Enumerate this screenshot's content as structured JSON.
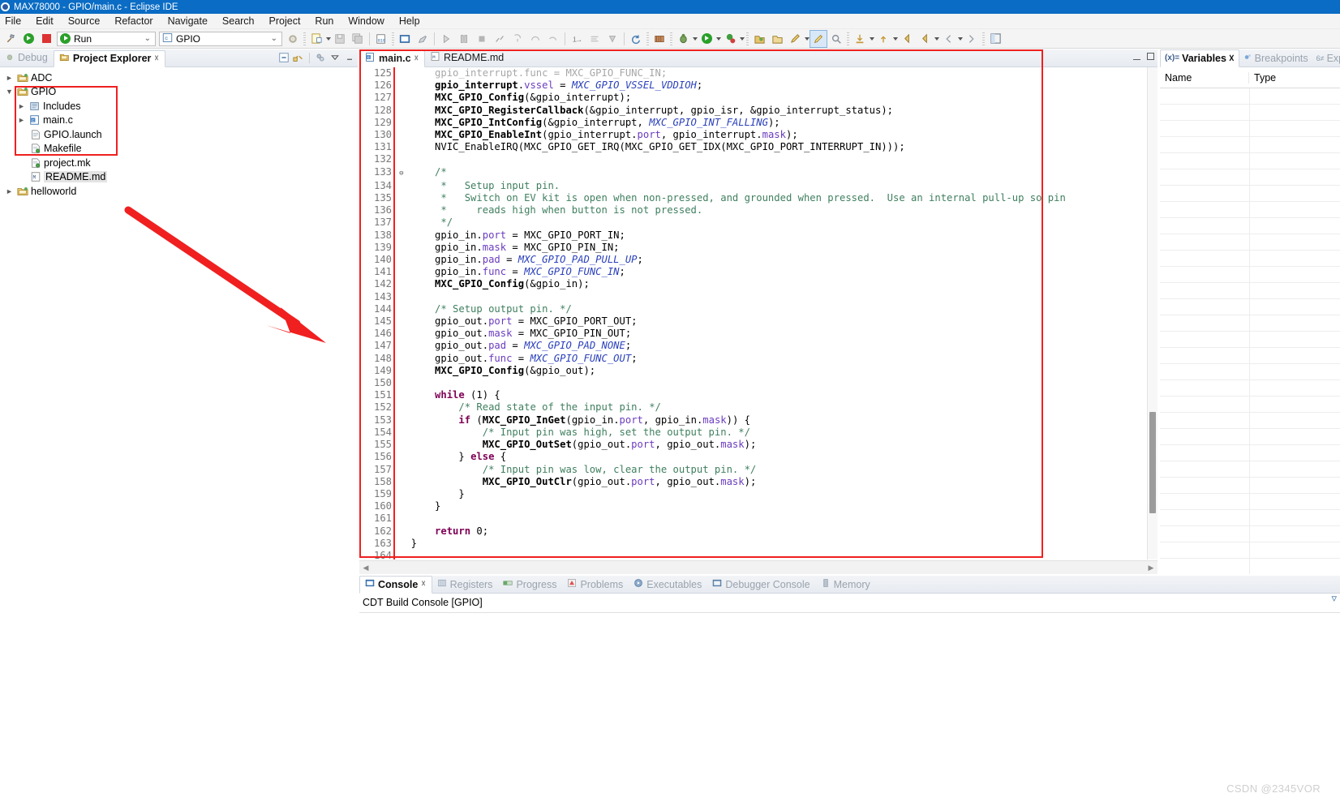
{
  "window": {
    "title": "MAX78000 - GPIO/main.c - Eclipse IDE",
    "app_icon": "eclipse-icon"
  },
  "menubar": {
    "items": [
      "File",
      "Edit",
      "Source",
      "Refactor",
      "Navigate",
      "Search",
      "Project",
      "Run",
      "Window",
      "Help"
    ]
  },
  "toolbar": {
    "run_config_label": "Run",
    "project_label": "GPIO",
    "icons": [
      "build-hammer-icon",
      "run-icon",
      "stop-icon",
      "new-file-icon",
      "save-icon",
      "save-all-icon",
      "binary-icon",
      "console-icon",
      "marker-icon",
      "resume-icon",
      "suspend-icon",
      "terminate-icon",
      "disconnect-icon",
      "step-into-icon",
      "step-over-icon",
      "step-return-icon",
      "instruction-step-icon",
      "skip-breakpoints-icon",
      "drop-to-frame-icon",
      "refresh-icon",
      "bug-icon",
      "external-tools-icon",
      "run-dropdown-icon",
      "debug-dropdown-icon",
      "open-type-icon",
      "open-resource-icon",
      "pencil-icon",
      "highlight-icon",
      "search-icon",
      "download-icon",
      "upload-icon",
      "back-icon",
      "forward-icon",
      "perspective-icon"
    ]
  },
  "left_panel": {
    "tabs": [
      {
        "label": "Debug",
        "icon": "debug-icon",
        "active": false,
        "closeable": false
      },
      {
        "label": "Project Explorer",
        "icon": "project-explorer-icon",
        "active": true,
        "closeable": true
      }
    ],
    "view_tools": [
      "collapse-all-icon",
      "link-editor-icon",
      "filter-icon",
      "view-menu-icon",
      "minimize-icon"
    ],
    "tree": [
      {
        "label": "ADC",
        "icon": "c-project-icon",
        "indent": 1,
        "arrow": "collapsed",
        "selected": false
      },
      {
        "label": "GPIO",
        "icon": "c-project-icon",
        "indent": 1,
        "arrow": "expanded",
        "selected": false
      },
      {
        "label": "Includes",
        "icon": "includes-icon",
        "indent": 2,
        "arrow": "collapsed",
        "selected": false
      },
      {
        "label": "main.c",
        "icon": "c-file-icon",
        "indent": 2,
        "arrow": "collapsed",
        "selected": false
      },
      {
        "label": "GPIO.launch",
        "icon": "launch-file-icon",
        "indent": 3,
        "arrow": "none",
        "selected": false
      },
      {
        "label": "Makefile",
        "icon": "makefile-icon",
        "indent": 3,
        "arrow": "none",
        "selected": false
      },
      {
        "label": "project.mk",
        "icon": "makefile-icon",
        "indent": 3,
        "arrow": "none",
        "selected": false
      },
      {
        "label": "README.md",
        "icon": "markdown-file-icon",
        "indent": 3,
        "arrow": "none",
        "selected": true
      },
      {
        "label": "helloworld",
        "icon": "c-project-icon",
        "indent": 1,
        "arrow": "none",
        "selected": false
      }
    ]
  },
  "editor": {
    "tabs": [
      {
        "label": "main.c",
        "icon": "c-file-icon",
        "active": true,
        "closeable": true
      },
      {
        "label": "README.md",
        "icon": "markdown-file-icon",
        "active": false,
        "closeable": false
      }
    ],
    "window_buttons": [
      "minimize-icon",
      "maximize-icon"
    ],
    "first_visible_line": 125,
    "last_visible_line": 164,
    "lines": [
      {
        "n": 125,
        "fold": "",
        "clipped": true,
        "text": "    gpio_interrupt.func = MXC_GPIO_FUNC_IN;"
      },
      {
        "n": 126,
        "fold": "",
        "text": "    gpio_interrupt.vssel = MXC_GPIO_VSSEL_VDDIOH;"
      },
      {
        "n": 127,
        "fold": "",
        "text": "    MXC_GPIO_Config(&gpio_interrupt);"
      },
      {
        "n": 128,
        "fold": "",
        "text": "    MXC_GPIO_RegisterCallback(&gpio_interrupt, gpio_isr, &gpio_interrupt_status);"
      },
      {
        "n": 129,
        "fold": "",
        "text": "    MXC_GPIO_IntConfig(&gpio_interrupt, MXC_GPIO_INT_FALLING);"
      },
      {
        "n": 130,
        "fold": "",
        "text": "    MXC_GPIO_EnableInt(gpio_interrupt.port, gpio_interrupt.mask);"
      },
      {
        "n": 131,
        "fold": "",
        "text": "    NVIC_EnableIRQ(MXC_GPIO_GET_IRQ(MXC_GPIO_GET_IDX(MXC_GPIO_PORT_INTERRUPT_IN)));"
      },
      {
        "n": 132,
        "fold": "",
        "text": ""
      },
      {
        "n": 133,
        "fold": "⊖",
        "text": "    /*"
      },
      {
        "n": 134,
        "fold": "",
        "text": "     *   Setup input pin."
      },
      {
        "n": 135,
        "fold": "",
        "text": "     *   Switch on EV kit is open when non-pressed, and grounded when pressed.  Use an internal pull-up so pin"
      },
      {
        "n": 136,
        "fold": "",
        "text": "     *     reads high when button is not pressed."
      },
      {
        "n": 137,
        "fold": "",
        "text": "     */"
      },
      {
        "n": 138,
        "fold": "",
        "text": "    gpio_in.port = MXC_GPIO_PORT_IN;"
      },
      {
        "n": 139,
        "fold": "",
        "text": "    gpio_in.mask = MXC_GPIO_PIN_IN;"
      },
      {
        "n": 140,
        "fold": "",
        "text": "    gpio_in.pad = MXC_GPIO_PAD_PULL_UP;"
      },
      {
        "n": 141,
        "fold": "",
        "text": "    gpio_in.func = MXC_GPIO_FUNC_IN;"
      },
      {
        "n": 142,
        "fold": "",
        "text": "    MXC_GPIO_Config(&gpio_in);"
      },
      {
        "n": 143,
        "fold": "",
        "text": ""
      },
      {
        "n": 144,
        "fold": "",
        "text": "    /* Setup output pin. */"
      },
      {
        "n": 145,
        "fold": "",
        "text": "    gpio_out.port = MXC_GPIO_PORT_OUT;"
      },
      {
        "n": 146,
        "fold": "",
        "text": "    gpio_out.mask = MXC_GPIO_PIN_OUT;"
      },
      {
        "n": 147,
        "fold": "",
        "text": "    gpio_out.pad = MXC_GPIO_PAD_NONE;"
      },
      {
        "n": 148,
        "fold": "",
        "text": "    gpio_out.func = MXC_GPIO_FUNC_OUT;"
      },
      {
        "n": 149,
        "fold": "",
        "text": "    MXC_GPIO_Config(&gpio_out);"
      },
      {
        "n": 150,
        "fold": "",
        "text": ""
      },
      {
        "n": 151,
        "fold": "",
        "text": "    while (1) {"
      },
      {
        "n": 152,
        "fold": "",
        "text": "        /* Read state of the input pin. */"
      },
      {
        "n": 153,
        "fold": "",
        "text": "        if (MXC_GPIO_InGet(gpio_in.port, gpio_in.mask)) {"
      },
      {
        "n": 154,
        "fold": "",
        "text": "            /* Input pin was high, set the output pin. */"
      },
      {
        "n": 155,
        "fold": "",
        "text": "            MXC_GPIO_OutSet(gpio_out.port, gpio_out.mask);"
      },
      {
        "n": 156,
        "fold": "",
        "text": "        } else {"
      },
      {
        "n": 157,
        "fold": "",
        "text": "            /* Input pin was low, clear the output pin. */"
      },
      {
        "n": 158,
        "fold": "",
        "text": "            MXC_GPIO_OutClr(gpio_out.port, gpio_out.mask);"
      },
      {
        "n": 159,
        "fold": "",
        "text": "        }"
      },
      {
        "n": 160,
        "fold": "",
        "text": "    }"
      },
      {
        "n": 161,
        "fold": "",
        "text": ""
      },
      {
        "n": 162,
        "fold": "",
        "text": "    return 0;"
      },
      {
        "n": 163,
        "fold": "",
        "text": "}"
      },
      {
        "n": 164,
        "fold": "",
        "text": ""
      }
    ]
  },
  "right_panel": {
    "tabs": [
      {
        "label": "Variables",
        "icon": "variables-icon",
        "active": true,
        "closeable": true
      },
      {
        "label": "Breakpoints",
        "icon": "breakpoints-icon",
        "active": false,
        "closeable": false
      },
      {
        "label": "Express",
        "icon": "expressions-icon",
        "active": false,
        "closeable": false
      }
    ],
    "columns": [
      "Name",
      "Type"
    ],
    "rows": []
  },
  "bottom_panel": {
    "tabs": [
      {
        "label": "Console",
        "icon": "console-icon",
        "active": true,
        "closeable": true
      },
      {
        "label": "Registers",
        "icon": "registers-icon",
        "active": false,
        "closeable": false
      },
      {
        "label": "Progress",
        "icon": "progress-icon",
        "active": false,
        "closeable": false
      },
      {
        "label": "Problems",
        "icon": "problems-icon",
        "active": false,
        "closeable": false
      },
      {
        "label": "Executables",
        "icon": "executables-icon",
        "active": false,
        "closeable": false
      },
      {
        "label": "Debugger Console",
        "icon": "debugger-console-icon",
        "active": false,
        "closeable": false
      },
      {
        "label": "Memory",
        "icon": "memory-icon",
        "active": false,
        "closeable": false
      }
    ],
    "console_title": "CDT Build Console [GPIO]",
    "console_text": ""
  },
  "annotations": {
    "highlight_color": "#f02020",
    "arrow": "red-arrow-annotation",
    "boxes": [
      "project-tree-highlight",
      "editor-highlight"
    ]
  },
  "watermark": "CSDN @2345VOR"
}
